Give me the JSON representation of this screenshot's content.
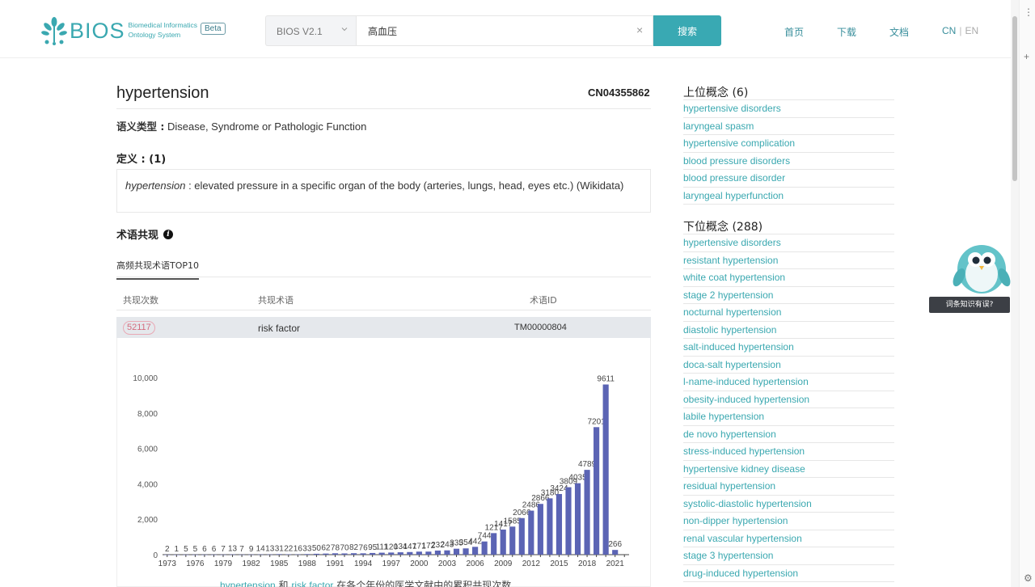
{
  "header": {
    "logo_text": "BIOS",
    "logo_sub_line1": "Biomedical Informatics",
    "logo_sub_line2": "Ontology System",
    "beta_badge": "Beta",
    "version_selected": "BIOS V2.1",
    "search_value": "高血压",
    "clear_symbol": "×",
    "search_button": "搜索",
    "nav": [
      "首页",
      "下载",
      "文档"
    ],
    "lang_cn": "CN",
    "lang_sep": "|",
    "lang_en": "EN"
  },
  "term": {
    "title": "hypertension",
    "id": "CN04355862",
    "semantic_type_label": "语义类型 :",
    "semantic_type_value": "Disease, Syndrome or Pathologic Function",
    "definition_label": "定义 : (1)",
    "definition_term": "hypertension",
    "definition_text": " : elevated pressure in a specific organ of the body (arteries, lungs, head, eyes etc.) (Wikidata)"
  },
  "cooccurrence": {
    "title": "术语共现",
    "tab_label": "高频共现术语TOP10",
    "columns": [
      "共现次数",
      "共现术语",
      "术语ID"
    ],
    "selected_row": {
      "count": "52117",
      "term": "risk factor",
      "id": "TM00000804"
    },
    "caption_term1": "hypertension",
    "caption_and": " 和 ",
    "caption_term2": "risk factor",
    "caption_rest": " 在各个年份的医学文献中的累积共现次数"
  },
  "chart_data": {
    "type": "bar",
    "x": [
      1973,
      1974,
      1975,
      1976,
      1977,
      1978,
      1979,
      1980,
      1981,
      1982,
      1983,
      1984,
      1985,
      1986,
      1987,
      1988,
      1989,
      1990,
      1991,
      1992,
      1993,
      1994,
      1995,
      1996,
      1997,
      1998,
      1999,
      2000,
      2001,
      2002,
      2003,
      2004,
      2005,
      2006,
      2007,
      2008,
      2009,
      2010,
      2011,
      2012,
      2013,
      2014,
      2015,
      2016,
      2017,
      2018,
      2019,
      2020,
      2021,
      2022
    ],
    "values": [
      2,
      1,
      5,
      5,
      6,
      6,
      7,
      13,
      7,
      9,
      14,
      13,
      31,
      22,
      16,
      33,
      50,
      62,
      78,
      70,
      82,
      76,
      95,
      111,
      120,
      134,
      147,
      171,
      172,
      232,
      243,
      335,
      354,
      442,
      744,
      1217,
      1417,
      1585,
      2066,
      2486,
      2866,
      3180,
      3424,
      3809,
      4035,
      4789,
      7201,
      9611,
      266
    ],
    "x_tick_labels": [
      "1973",
      "1976",
      "1979",
      "1982",
      "1985",
      "1988",
      "1991",
      "1994",
      "1997",
      "2000",
      "2003",
      "2006",
      "2009",
      "2012",
      "2015",
      "2018",
      "2021"
    ],
    "y_ticks": [
      "0",
      "2,000",
      "4,000",
      "6,000",
      "8,000",
      "10,000"
    ],
    "ylim": [
      0,
      10000
    ],
    "bar_color": "#5b64b4",
    "grid": false
  },
  "superordinate": {
    "heading": "上位概念 (6)",
    "items": [
      "hypertensive disorders",
      "laryngeal spasm",
      "hypertensive complication",
      "blood pressure disorders",
      "blood pressure disorder",
      "laryngeal hyperfunction"
    ]
  },
  "subordinate": {
    "heading": "下位概念 (288)",
    "items": [
      "hypertensive disorders",
      "resistant hypertension",
      "white coat hypertension",
      "stage 2 hypertension",
      "nocturnal hypertension",
      "diastolic hypertension",
      "salt-induced hypertension",
      "doca-salt hypertension",
      "l-name-induced hypertension",
      "obesity-induced hypertension",
      "labile hypertension",
      "de novo hypertension",
      "stress-induced hypertension",
      "hypertensive kidney disease",
      "residual hypertension",
      "systolic-diastolic hypertension",
      "non-dipper hypertension",
      "renal vascular hypertension",
      "stage 3 hypertension",
      "drug-induced hypertension"
    ]
  },
  "mascot": {
    "label": "词条知识有误?"
  },
  "colors": {
    "accent": "#39a9b3",
    "link": "#3aa8b0",
    "badge_pink": "#d46b7e"
  }
}
